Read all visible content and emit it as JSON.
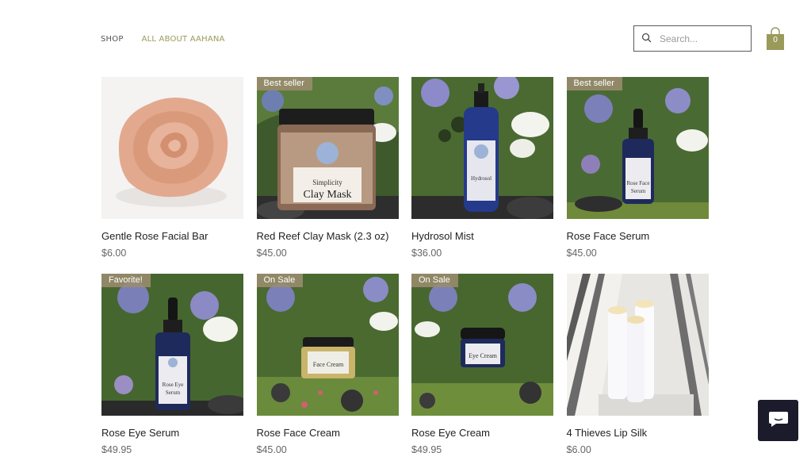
{
  "nav": {
    "shop": "SHOP",
    "about": "ALL ABOUT AAHANA"
  },
  "search": {
    "placeholder": "Search..."
  },
  "cart": {
    "count": "0",
    "color": "#9a9a5a"
  },
  "products": [
    {
      "name": "Gentle Rose Facial Bar",
      "price": "$6.00",
      "ribbon": "",
      "image": "rose-soap"
    },
    {
      "name": "Red Reef Clay Mask (2.3 oz)",
      "price": "$45.00",
      "ribbon": "Best seller",
      "image": "clay-mask-jar"
    },
    {
      "name": "Hydrosol Mist",
      "price": "$36.00",
      "ribbon": "",
      "image": "spray-bottle"
    },
    {
      "name": "Rose Face Serum",
      "price": "$45.00",
      "ribbon": "Best seller",
      "image": "dropper-bottle"
    },
    {
      "name": "Rose Eye Serum",
      "price": "$49.95",
      "ribbon": "Favorite!",
      "image": "dropper-bottle"
    },
    {
      "name": "Rose Face Cream",
      "price": "$45.00",
      "ribbon": "On Sale",
      "image": "cream-jar"
    },
    {
      "name": "Rose Eye Cream",
      "price": "$49.95",
      "ribbon": "On Sale",
      "image": "cream-jar"
    },
    {
      "name": "4 Thieves Lip Silk",
      "price": "$6.00",
      "ribbon": "",
      "image": "lip-balm-tubes"
    }
  ],
  "chat": {
    "icon": "chat-icon"
  }
}
